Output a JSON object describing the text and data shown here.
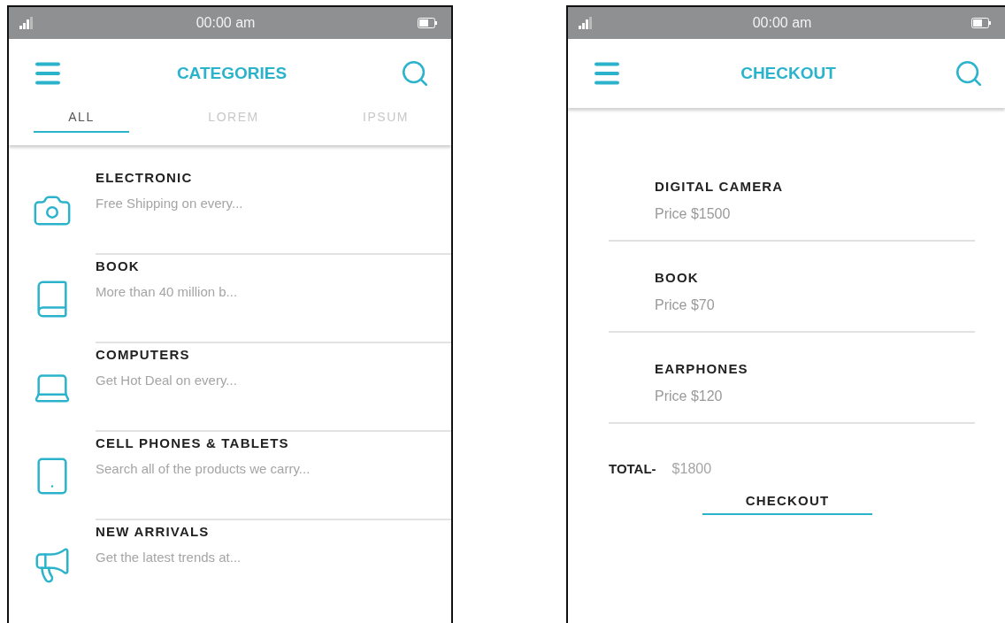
{
  "screens": [
    {
      "kind": "categories",
      "status_bar": {
        "time": "00:00 am"
      },
      "title": "CATEGORIES",
      "tabs": [
        {
          "label": "ALL",
          "selected": true
        },
        {
          "label": "LOREM",
          "selected": false
        },
        {
          "label": "IPSUM",
          "selected": false
        }
      ],
      "items": [
        {
          "title": "ELECTRONIC",
          "subtitle": "Free Shipping on every..."
        },
        {
          "title": "BOOK",
          "subtitle": "More than 40 million b..."
        },
        {
          "title": "COMPUTERS",
          "subtitle": "Get Hot Deal on every..."
        },
        {
          "title": "CELL PHONES & TABLETS",
          "subtitle": "Search all of the products we carry..."
        },
        {
          "title": "NEW ARRIVALS",
          "subtitle": "Get the latest trends at..."
        }
      ]
    },
    {
      "kind": "checkout",
      "status_bar": {
        "time": "00:00 am"
      },
      "title": "CHECKOUT",
      "items": [
        {
          "name": "DIGITAL CAMERA",
          "price": "Price $1500"
        },
        {
          "name": "BOOK",
          "price": "Price $70"
        },
        {
          "name": "EARPHONES",
          "price": "Price $120"
        }
      ],
      "total": {
        "label": "TOTAL-",
        "amount": "$1800"
      },
      "button": "CHECKOUT"
    }
  ]
}
